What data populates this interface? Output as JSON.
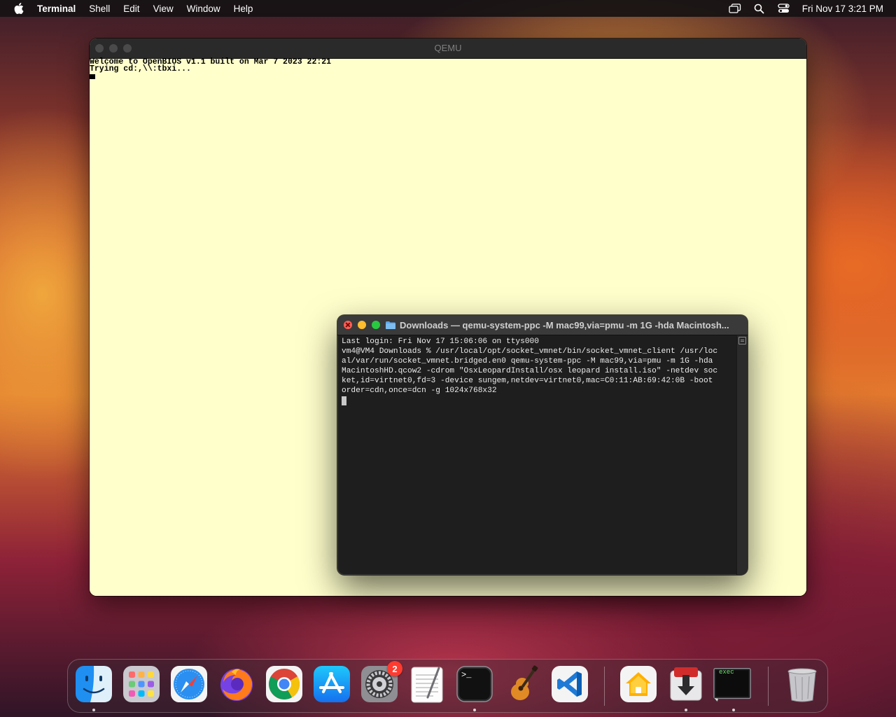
{
  "menubar": {
    "app_name": "Terminal",
    "menus": [
      "Shell",
      "Edit",
      "View",
      "Window",
      "Help"
    ],
    "clock": "Fri Nov 17  3:21 PM",
    "tray_icons": [
      "screen-mirroring-icon",
      "spotlight-search-icon",
      "control-center-icon"
    ]
  },
  "qemu": {
    "title": "QEMU",
    "screen_lines": [
      "Welcome to OpenBIOS v1.1 built on Mar 7 2023 22:21",
      "Trying cd:,\\\\:tbxi..."
    ],
    "background_color": "#ffffcc"
  },
  "terminal": {
    "title": "Downloads — qemu-system-ppc -M mac99,via=pmu -m 1G -hda Macintosh...",
    "lines": [
      "Last login: Fri Nov 17 15:06:06 on ttys000",
      "vm4@VM4 Downloads % /usr/local/opt/socket_vmnet/bin/socket_vmnet_client /usr/loc",
      "al/var/run/socket_vmnet.bridged.en0 qemu-system-ppc -M mac99,via=pmu -m 1G -hda",
      "MacintoshHD.qcow2 -cdrom \"OsxLeopardInstall/osx leopard install.iso\" -netdev soc",
      "ket,id=virtnet0,fd=3 -device sungem,netdev=virtnet0,mac=C0:11:AB:69:42:0B -boot",
      "order=cdn,once=dcn -g 1024x768x32"
    ],
    "background_color": "#1e1e1e"
  },
  "dock": {
    "items": [
      {
        "name": "Finder",
        "icon": "finder-icon",
        "running": true
      },
      {
        "name": "Launchpad",
        "icon": "launchpad-icon",
        "running": false
      },
      {
        "name": "Safari",
        "icon": "safari-icon",
        "running": false
      },
      {
        "name": "Firefox",
        "icon": "firefox-icon",
        "running": false
      },
      {
        "name": "Google Chrome",
        "icon": "chrome-icon",
        "running": false
      },
      {
        "name": "App Store",
        "icon": "app-store-icon",
        "running": false
      },
      {
        "name": "System Settings",
        "icon": "system-settings-icon",
        "running": false,
        "badge": "2"
      },
      {
        "name": "TextEdit",
        "icon": "textedit-icon",
        "running": false
      },
      {
        "name": "Terminal",
        "icon": "terminal-icon",
        "running": true
      },
      {
        "name": "GarageBand",
        "icon": "garageband-icon",
        "running": false
      },
      {
        "name": "Visual Studio Code",
        "icon": "vscode-icon",
        "running": false
      },
      {
        "name": "Home",
        "icon": "home-icon",
        "running": false
      },
      {
        "name": "Downloads",
        "icon": "downloads-icon",
        "running": true
      },
      {
        "name": "exec",
        "icon": "exec-icon",
        "running": true,
        "label": "exec"
      },
      {
        "name": "Trash",
        "icon": "trash-icon",
        "running": false
      }
    ]
  }
}
